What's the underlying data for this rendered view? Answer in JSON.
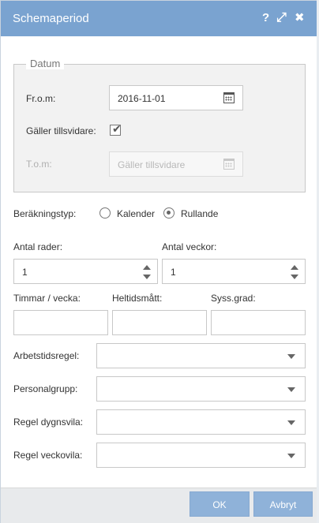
{
  "titlebar": {
    "title": "Schemaperiod",
    "help_glyph": "?",
    "expand_glyph": "⤢",
    "close_glyph": "✖"
  },
  "datum": {
    "legend": "Datum",
    "from_label": "Fr.o.m:",
    "from_value": "2016-11-01",
    "galler_label": "Gäller tillsvidare:",
    "galler_checked": true,
    "tom_label": "T.o.m:",
    "tom_placeholder": "Gäller tillsvidare"
  },
  "berakning": {
    "label": "Beräkningstyp:",
    "options": [
      {
        "label": "Kalender",
        "selected": false
      },
      {
        "label": "Rullande",
        "selected": true
      }
    ]
  },
  "antal_rader": {
    "label": "Antal rader:",
    "value": "1"
  },
  "antal_veckor": {
    "label": "Antal veckor:",
    "value": "1"
  },
  "timmar_vecka": {
    "label": "Timmar / vecka:",
    "value": ""
  },
  "heltidsmatt": {
    "label": "Heltidsmått:",
    "value": ""
  },
  "syss_grad": {
    "label": "Syss.grad:",
    "value": ""
  },
  "arbetstidsregel": {
    "label": "Arbetstidsregel:",
    "value": ""
  },
  "personalgrupp": {
    "label": "Personalgrupp:",
    "value": ""
  },
  "regel_dygnsvila": {
    "label": "Regel dygnsvila:",
    "value": ""
  },
  "regel_veckovila": {
    "label": "Regel veckovila:",
    "value": ""
  },
  "footer": {
    "ok_label": "OK",
    "cancel_label": "Avbryt"
  }
}
